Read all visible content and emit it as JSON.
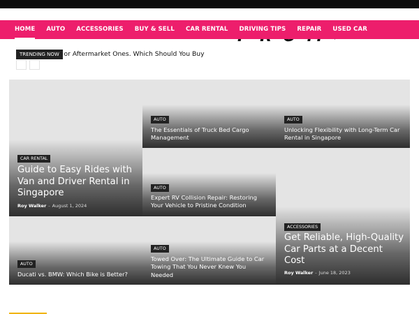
{
  "nav": {
    "items": [
      {
        "label": "HOME"
      },
      {
        "label": "AUTO"
      },
      {
        "label": "ACCESSORIES"
      },
      {
        "label": "BUY & SELL"
      },
      {
        "label": "CAR RENTAL"
      },
      {
        "label": "DRIVING TIPS"
      },
      {
        "label": "REPAIR"
      },
      {
        "label": "USED CAR"
      }
    ]
  },
  "logo": {
    "text": "PROMO"
  },
  "trending": {
    "label": "TRENDING NOW",
    "headline": "OEM Car Parts or Aftermarket Ones. Which Should You Buy"
  },
  "posts": {
    "feature_left": {
      "category": "CAR RENTAL",
      "title": "Guide to Easy Rides with Van and Driver Rental in Singapore",
      "author": "Roy Walker",
      "separator": "-",
      "date": "August 1, 2024"
    },
    "truck_bed": {
      "category": "AUTO",
      "title": "The Essentials of Truck Bed Cargo Management"
    },
    "long_term": {
      "category": "AUTO",
      "title": "Unlocking Flexibility with Long-Term Car Rental in Singapore"
    },
    "rv_repair": {
      "category": "AUTO",
      "title": "Expert RV Collision Repair: Restoring Your Vehicle to Pristine Condition"
    },
    "car_parts": {
      "category": "ACCESSORIES",
      "title": "Get Reliable, High-Quality Car Parts at a Decent Cost",
      "author": "Roy Walker",
      "separator": "-",
      "date": "June 18, 2023"
    },
    "ducati": {
      "category": "AUTO",
      "title": "Ducati vs. BMW: Which Bike is Better?"
    },
    "towing": {
      "category": "AUTO",
      "title": "Towed Over: The Ultimate Guide to Car Towing That You Never Knew You Needed"
    }
  },
  "colors": {
    "accent": "#ed1e6c",
    "topbar": "#0d0d0d",
    "badge": "#222222",
    "tile_placeholder": "#e4e4e4"
  },
  "icons": {
    "trending_prev": "chevron-left-icon",
    "trending_next": "chevron-right-icon"
  }
}
